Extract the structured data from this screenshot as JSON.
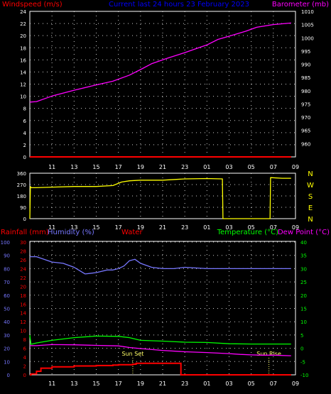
{
  "colors": {
    "background": "#000000",
    "frame": "#ffffff",
    "grid": "#ffffff",
    "tick_label": "#ffffff",
    "windspeed": "#ff0000",
    "barometer": "#ff00ff",
    "direction": "#ffff00",
    "compass": "#ffff00",
    "rainfall": "#ff0000",
    "humidity": "#7777ff",
    "water": "#ff0000",
    "temperature": "#00ff00",
    "dewpoint": "#ff00ff",
    "title": "#0000ff",
    "sun_marker": "#ffff66"
  },
  "chart_data": [
    {
      "type": "line",
      "title": "Current last 24 hours 23 February 2023",
      "left_axis_label": "Windspeed (m/s)",
      "right_axis_label": "Barometer (mb)",
      "x_ticks": [
        "11",
        "13",
        "15",
        "17",
        "19",
        "21",
        "23",
        "01",
        "03",
        "05",
        "07",
        "09"
      ],
      "left_ticks": [
        "0",
        "2",
        "4",
        "6",
        "8",
        "10",
        "12",
        "14",
        "16",
        "18",
        "20",
        "22",
        "24"
      ],
      "right_ticks": [
        "960",
        "965",
        "970",
        "975",
        "980",
        "985",
        "990",
        "995",
        "1000",
        "1005",
        "1010"
      ],
      "ylim_left": [
        0,
        24
      ],
      "ylim_right": [
        955,
        1010
      ],
      "series": [
        {
          "name": "Barometer",
          "axis": "right",
          "x": [
            0,
            0.6,
            2,
            4,
            6,
            7.5,
            9,
            10,
            11,
            12.5,
            14,
            15,
            16,
            17,
            18,
            19.5,
            20.5,
            22,
            23.6
          ],
          "values": [
            975.7,
            975.9,
            978,
            980.2,
            982.2,
            983.6,
            985.9,
            988,
            990.2,
            992.4,
            994.4,
            995.9,
            997.3,
            999.4,
            1000.6,
            1002.5,
            1004,
            1005,
            1005.6
          ]
        },
        {
          "name": "Windspeed",
          "axis": "left",
          "x": [
            0,
            23.6
          ],
          "values": [
            0,
            0
          ]
        }
      ],
      "grid": true
    },
    {
      "type": "line",
      "left_ticks": [
        "0",
        "90",
        "180",
        "270",
        "360"
      ],
      "compass_labels": [
        "N",
        "W",
        "S",
        "E",
        "N"
      ],
      "x_ticks": [
        "11",
        "13",
        "15",
        "17",
        "19",
        "21",
        "23",
        "01",
        "03",
        "05",
        "07",
        "09"
      ],
      "ylim": [
        0,
        360
      ],
      "series": [
        {
          "name": "Wind direction",
          "x": [
            0,
            0.05,
            0.1,
            0.6,
            2,
            4,
            6,
            7.5,
            8.3,
            9,
            10,
            12,
            14,
            16,
            17.4,
            17.45,
            21.7,
            21.75,
            22.8,
            23.6
          ],
          "values": [
            0,
            255,
            245,
            245,
            250,
            255,
            255,
            262,
            290,
            300,
            305,
            305,
            315,
            318,
            315,
            0,
            0,
            325,
            320,
            320
          ]
        }
      ],
      "grid": true
    },
    {
      "type": "line",
      "labels": [
        "Rainfall (mm)",
        "Humidity (%)",
        "Water",
        "Temperature (°C)",
        "Dew Point (°C)"
      ],
      "humidity_ticks": [
        "0",
        "10",
        "20",
        "30",
        "40",
        "50",
        "60",
        "70",
        "80",
        "90",
        "100"
      ],
      "rain_ticks": [
        "0",
        "2",
        "4",
        "6",
        "8",
        "10",
        "12",
        "14",
        "16",
        "18",
        "20",
        "22",
        "24",
        "26",
        "28",
        "30"
      ],
      "temp_ticks": [
        "-10",
        "-5",
        "0",
        "5",
        "10",
        "15",
        "20",
        "25",
        "30",
        "35",
        "40"
      ],
      "x_ticks": [
        "11",
        "13",
        "15",
        "17",
        "19",
        "21",
        "23",
        "01",
        "03",
        "05",
        "07",
        "09"
      ],
      "annotations": [
        {
          "text": "Sun Set",
          "x": 9.3
        },
        {
          "text": "Sun Rise",
          "x": 21.6
        }
      ],
      "ylim_humidity": [
        0,
        100
      ],
      "ylim_temp": [
        -10,
        40
      ],
      "ylim_rain": [
        0,
        30
      ],
      "series": [
        {
          "name": "Humidity",
          "axis": "humidity",
          "x": [
            0,
            0.6,
            2,
            3,
            4,
            5,
            6,
            7,
            7.5,
            8,
            8.5,
            9,
            9.5,
            10,
            11,
            12,
            13,
            14,
            16,
            18,
            20,
            22,
            23.6
          ],
          "values": [
            89,
            89,
            85,
            84,
            81,
            76,
            77,
            79,
            79,
            80,
            82,
            86,
            87,
            84,
            81,
            80,
            80,
            81,
            80,
            80,
            80,
            80,
            80
          ]
        },
        {
          "name": "Temperature",
          "axis": "temp",
          "x": [
            0,
            0.1,
            0.6,
            2,
            4,
            6,
            8,
            9,
            9.5,
            10,
            12,
            14,
            16,
            18,
            20,
            22,
            23.6
          ],
          "values": [
            5,
            1.5,
            2,
            3,
            4,
            4.6,
            4.5,
            4,
            3.5,
            3,
            2.7,
            2.3,
            2.2,
            1.7,
            1.6,
            1.6,
            1.6
          ]
        },
        {
          "name": "Dew Point",
          "axis": "temp",
          "x": [
            0,
            0.6,
            2,
            4,
            6,
            8,
            9,
            10,
            12,
            14,
            16,
            18,
            19,
            20,
            21,
            22,
            23.6
          ],
          "values": [
            1,
            1,
            1.4,
            1.3,
            1.1,
            0.9,
            0.3,
            -0.1,
            -0.8,
            -1.3,
            -1.6,
            -2,
            -2.3,
            -2.5,
            -2.6,
            -2.6,
            -2.8
          ]
        },
        {
          "name": "Rainfall",
          "axis": "rain",
          "x": [
            0,
            0.1,
            0.6,
            1,
            2,
            4,
            6,
            7.5,
            8,
            9.3,
            9.6,
            12,
            13.6,
            13.65,
            23.6
          ],
          "values": [
            0,
            0.2,
            0.8,
            1.5,
            1.8,
            2,
            2.1,
            2.2,
            2.3,
            2.4,
            2.6,
            2.6,
            2.6,
            0,
            0
          ]
        }
      ],
      "grid": true
    }
  ]
}
